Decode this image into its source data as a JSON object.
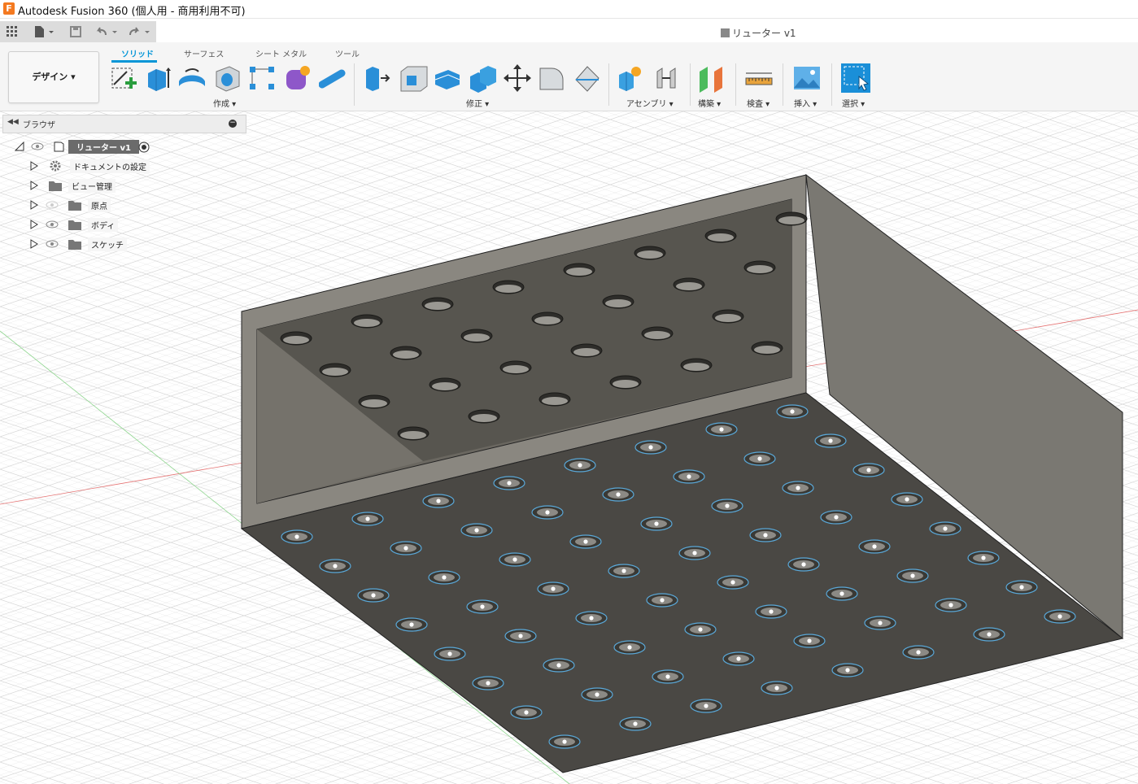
{
  "window": {
    "app_letter": "F",
    "title": "Autodesk Fusion 360 (個人用 - 商用利用不可)"
  },
  "document": {
    "title": "リューター v1"
  },
  "toolbar": {
    "workspace": "デザイン",
    "tabs": [
      "ソリッド",
      "サーフェス",
      "シート メタル",
      "ツール"
    ],
    "groups": {
      "create": "作成",
      "modify": "修正",
      "assembly": "アセンブリ",
      "construct": "構築",
      "inspect": "検査",
      "insert": "挿入",
      "select": "選択"
    }
  },
  "browser": {
    "title": "ブラウザ",
    "root": "リューター v1",
    "items": [
      "ドキュメントの設定",
      "ビュー管理",
      "原点",
      "ボディ",
      "スケッチ"
    ]
  },
  "colors": {
    "accent": "#0696d7",
    "body": "#4a4844",
    "hole_edge": "#5aa8d8"
  }
}
